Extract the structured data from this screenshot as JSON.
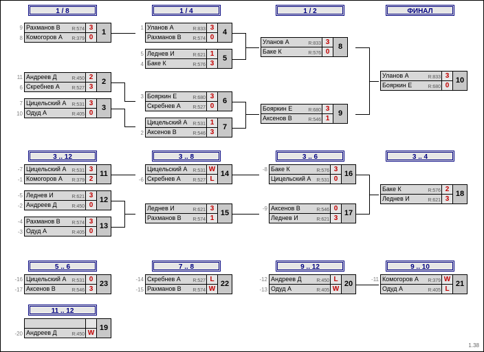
{
  "version": "1.38",
  "headers": {
    "r8": "1 / 8",
    "r4": "1 / 4",
    "r2": "1 / 2",
    "fin": "ФИНАЛ",
    "p312": "3 .. 12",
    "p38": "3 .. 8",
    "p36": "3 .. 6",
    "p34": "3 .. 4",
    "p56": "5 .. 6",
    "p78": "7 .. 8",
    "p912": "9 .. 12",
    "p910": "9 .. 10",
    "p1112": "11 .. 12"
  },
  "matches": {
    "m1": {
      "n": "1",
      "s1": "9",
      "s2": "8",
      "p1": "Рахманов В",
      "r1": "R:574",
      "sc1": "3",
      "p2": "Комогоров А",
      "r2": "R:379",
      "sc2": "0"
    },
    "m2": {
      "n": "2",
      "s1": "11",
      "s2": "6",
      "p1": "Андреев Д",
      "r1": "R:450",
      "sc1": "2",
      "p2": "Скребнев А",
      "r2": "R:527",
      "sc2": "3"
    },
    "m3": {
      "n": "3",
      "s1": "7",
      "s2": "10",
      "p1": "Цицельский А",
      "r1": "R:531",
      "sc1": "3",
      "p2": "Одуд А",
      "r2": "R:405",
      "sc2": "0"
    },
    "m4": {
      "n": "4",
      "s1": "1",
      "s2": "",
      "p1": "Уланов А",
      "r1": "R:833",
      "sc1": "3",
      "p2": "Рахманов В",
      "r2": "R:574",
      "sc2": "0"
    },
    "m5": {
      "n": "5",
      "s1": "5",
      "s2": "4",
      "p1": "Леднев И",
      "r1": "R:621",
      "sc1": "1",
      "p2": "Баке К",
      "r2": "R:576",
      "sc2": "3"
    },
    "m6": {
      "n": "6",
      "s1": "3",
      "s2": "",
      "p1": "Бояркин Е",
      "r1": "R:680",
      "sc1": "3",
      "p2": "Скребнев А",
      "r2": "R:527",
      "sc2": "0"
    },
    "m7": {
      "n": "7",
      "s1": "",
      "s2": "2",
      "p1": "Цицельский А",
      "r1": "R:531",
      "sc1": "1",
      "p2": "Аксенов В",
      "r2": "R:546",
      "sc2": "3"
    },
    "m8": {
      "n": "8",
      "p1": "Уланов А",
      "r1": "R:833",
      "sc1": "3",
      "p2": "Баке К",
      "r2": "R:576",
      "sc2": "0"
    },
    "m9": {
      "n": "9",
      "p1": "Бояркин Е",
      "r1": "R:680",
      "sc1": "3",
      "p2": "Аксенов В",
      "r2": "R:546",
      "sc2": "1"
    },
    "m10": {
      "n": "10",
      "p1": "Уланов А",
      "r1": "R:833",
      "sc1": "3",
      "p2": "Бояркин Е",
      "r2": "R:680",
      "sc2": "0"
    },
    "m11": {
      "n": "11",
      "s1": "-7",
      "s2": "-1",
      "p1": "Цицельский А",
      "r1": "R:531",
      "sc1": "3",
      "p2": "Комогоров А",
      "r2": "R:379",
      "sc2": "2"
    },
    "m12": {
      "n": "12",
      "s1": "-5",
      "s2": "-2",
      "p1": "Леднев И",
      "r1": "R:621",
      "sc1": "3",
      "p2": "Андреев Д",
      "r2": "R:450",
      "sc2": "0"
    },
    "m13": {
      "n": "13",
      "s1": "-4",
      "s2": "-3",
      "p1": "Рахманов В",
      "r1": "R:574",
      "sc1": "3",
      "p2": "Одуд А",
      "r2": "R:405",
      "sc2": "0"
    },
    "m14": {
      "n": "14",
      "s1": "",
      "s2": "-6",
      "p1": "Цицельский А",
      "r1": "R:531",
      "sc1": "W",
      "p2": "Скребнев А",
      "r2": "R:527",
      "sc2": "L"
    },
    "m15": {
      "n": "15",
      "p1": "Леднев И",
      "r1": "R:621",
      "sc1": "3",
      "p2": "Рахманов В",
      "r2": "R:574",
      "sc2": "1"
    },
    "m16": {
      "n": "16",
      "s1": "-8",
      "p1": "Баке К",
      "r1": "R:576",
      "sc1": "3",
      "p2": "Цицельский А",
      "r2": "R:531",
      "sc2": "0"
    },
    "m17": {
      "n": "17",
      "s1": "-9",
      "p1": "Аксенов В",
      "r1": "R:546",
      "sc1": "0",
      "p2": "Леднев И",
      "r2": "R:621",
      "sc2": "3"
    },
    "m18": {
      "n": "18",
      "p1": "Баке К",
      "r1": "R:576",
      "sc1": "2",
      "p2": "Леднев И",
      "r2": "R:621",
      "sc2": "3"
    },
    "m23": {
      "n": "23",
      "s1": "-16",
      "s2": "-17",
      "p1": "Цицельский А",
      "r1": "R:531",
      "sc1": "0",
      "p2": "Аксенов В",
      "r2": "R:546",
      "sc2": "3"
    },
    "m22": {
      "n": "22",
      "s1": "-14",
      "s2": "-15",
      "p1": "Скребнев А",
      "r1": "R:527",
      "sc1": "L",
      "p2": "Рахманов В",
      "r2": "R:574",
      "sc2": "W"
    },
    "m20": {
      "n": "20",
      "s1": "-12",
      "s2": "-13",
      "p1": "Андреев Д",
      "r1": "R:450",
      "sc1": "L",
      "p2": "Одуд А",
      "r2": "R:405",
      "sc2": "W"
    },
    "m21": {
      "n": "21",
      "s1": "-11",
      "p1": "Комогоров А",
      "r1": "R:379",
      "sc1": "W",
      "p2": "Одуд А",
      "r2": "R:405",
      "sc2": "L"
    },
    "m19": {
      "n": "19",
      "s1": "",
      "s2": "-20",
      "p1": "",
      "r1": "",
      "sc1": "",
      "p2": "Андреев Д",
      "r2": "R:450",
      "sc2": "W"
    }
  },
  "chart_data": {
    "type": "table",
    "title": "Single-elimination tournament bracket with consolation rounds",
    "rounds": [
      "1/8",
      "1/4",
      "1/2",
      "ФИНАЛ",
      "3..12",
      "3..8",
      "3..6",
      "3..4",
      "5..6",
      "7..8",
      "9..12",
      "9..10",
      "11..12"
    ],
    "final": {
      "winner": "Уланов А",
      "runner_up": "Бояркин Е",
      "score": "3-0"
    }
  }
}
